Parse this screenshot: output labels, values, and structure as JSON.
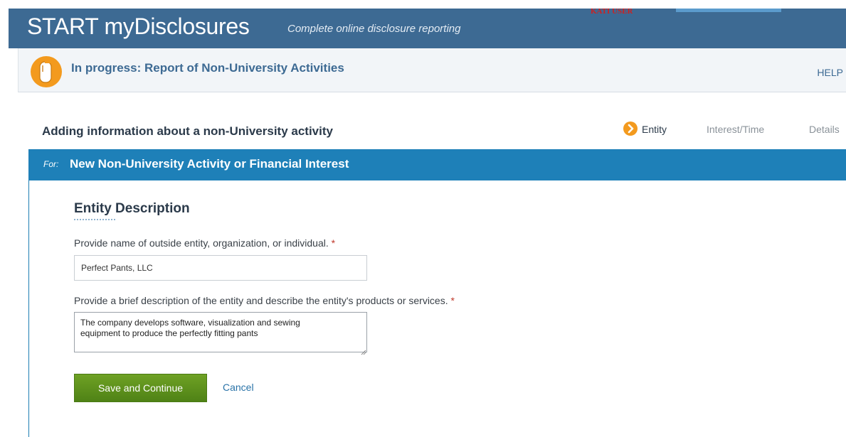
{
  "header": {
    "app_name": "START myDisclosures",
    "tagline": "Complete online disclosure reporting",
    "user_label": "KATI USER"
  },
  "progress": {
    "icon": "document-icon",
    "title": "In progress: Report of Non-University Activities",
    "help_label": "HELP"
  },
  "wizard": {
    "heading": "Adding information about a non-University activity",
    "steps": [
      {
        "label": "Entity",
        "current": true
      },
      {
        "label": "Interest/Time",
        "current": false
      },
      {
        "label": "Details",
        "current": false
      }
    ]
  },
  "panel": {
    "for_label": "For:",
    "title": "New Non-University Activity or Financial Interest"
  },
  "form": {
    "section_title": "Entity Description",
    "name_label": "Provide name of outside entity, organization, or individual.",
    "name_value": "Perfect Pants, LLC",
    "description_label": "Provide a brief description of the entity and describe the entity's products or services.",
    "description_value": "The company develops software, visualization and sewing\nequipment to produce the perfectly fitting pants",
    "required_marker": "*",
    "save_label": "Save and Continue",
    "cancel_label": "Cancel"
  },
  "colors": {
    "header_bg": "#3d6a93",
    "panel_header_bg": "#1e80b8",
    "accent_orange": "#f39a1e",
    "save_green": "#5a8f1c",
    "link_blue": "#2a73a8"
  }
}
